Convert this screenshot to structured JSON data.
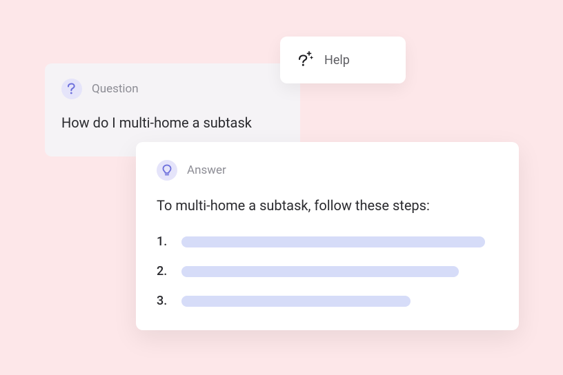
{
  "help": {
    "label": "Help"
  },
  "question": {
    "header_label": "Question",
    "text": "How do I multi-home a subtask"
  },
  "answer": {
    "header_label": "Answer",
    "intro": "To multi-home a subtask, follow these steps:",
    "steps": [
      "1.",
      "2.",
      "3."
    ]
  },
  "colors": {
    "background": "#FDE7E9",
    "icon_circle": "#E5E4FA",
    "icon_fg": "#6B6EDB",
    "skeleton_bar": "#D6DCF8"
  }
}
